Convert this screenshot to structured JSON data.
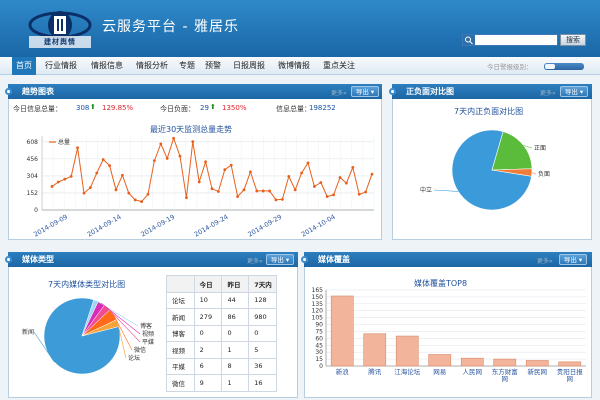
{
  "header": {
    "logo_text": "建材舆情",
    "title": "云服务平台 - 雅居乐",
    "search_button": "搜索"
  },
  "nav": {
    "items": [
      "首页",
      "行业情报",
      "情报信息",
      "情报分析",
      "专题",
      "预警",
      "日报周报",
      "微博情报",
      "重点关注"
    ],
    "alert_label": "今日警报级别："
  },
  "panels": {
    "trend": {
      "title": "趋势图表",
      "more": "更多»",
      "export": "导出",
      "stats": {
        "total_label": "今日信息总量：",
        "total_value": "308",
        "total_pct": "129.85%",
        "negative_label": "今日负面：",
        "negative_value": "29",
        "negative_pct": "1350%",
        "all_label": "信息总量：",
        "all_value": "198252"
      }
    },
    "sentiment": {
      "title": "正负面对比图",
      "more": "更多»",
      "export": "导出"
    },
    "media_type": {
      "title": "媒体类型",
      "more": "更多»",
      "export": "导出"
    },
    "media_cover": {
      "title": "媒体覆盖",
      "more": "更多»",
      "export": "导出"
    }
  },
  "colors": {
    "header": "#1f75b8",
    "line": "#e8601c",
    "pie_neutral": "#3b9ad9",
    "pie_positive": "#5bbb3a",
    "pie_negative": "#ef7d37",
    "bar": "#f2b49a"
  },
  "chart_data": [
    {
      "type": "line",
      "title": "最近30天监测总量走势",
      "legend": "总量",
      "x_ticks": [
        "2014-09-09",
        "2014-09-14",
        "2014-09-19",
        "2014-09-24",
        "2014-09-29",
        "2014-10-04"
      ],
      "y_ticks": [
        0,
        152,
        304,
        456,
        608
      ],
      "ylim": [
        0,
        660
      ],
      "values": [
        210,
        250,
        275,
        300,
        555,
        150,
        200,
        330,
        450,
        395,
        180,
        310,
        150,
        90,
        75,
        140,
        440,
        590,
        460,
        640,
        480,
        110,
        610,
        250,
        430,
        190,
        165,
        360,
        400,
        120,
        180,
        340,
        170,
        170,
        170,
        90,
        95,
        300,
        180,
        330,
        420,
        210,
        245,
        120,
        135,
        290,
        240,
        380,
        140,
        160,
        320
      ]
    },
    {
      "type": "pie",
      "title": "7天内正负面对比图",
      "labels": [
        "中立",
        "正面",
        "负面"
      ],
      "values": [
        77,
        20,
        3
      ]
    },
    {
      "type": "pie",
      "title": "7天内媒体类型对比图",
      "labels": [
        "新闻",
        "博客",
        "视频",
        "平媒",
        "微信",
        "论坛"
      ],
      "values": [
        84,
        2,
        3,
        3,
        5,
        3
      ]
    },
    {
      "type": "table",
      "columns": [
        "",
        "今日",
        "昨日",
        "7天内"
      ],
      "rows": [
        [
          "论坛",
          "10",
          "44",
          "128"
        ],
        [
          "新闻",
          "279",
          "86",
          "980"
        ],
        [
          "博客",
          "0",
          "0",
          "0"
        ],
        [
          "视频",
          "2",
          "1",
          "5"
        ],
        [
          "平媒",
          "6",
          "8",
          "36"
        ],
        [
          "微信",
          "9",
          "1",
          "16"
        ]
      ]
    },
    {
      "type": "bar",
      "title": "媒体覆盖TOP8",
      "categories": [
        "新浪",
        "腾讯",
        "江海论坛",
        "网易",
        "人民网",
        "东方财富网",
        "新民网",
        "贵阳日报网"
      ],
      "values": [
        152,
        70,
        65,
        25,
        17,
        15,
        12,
        9
      ],
      "y_ticks": [
        0,
        15,
        30,
        45,
        60,
        75,
        90,
        105,
        120,
        135,
        150,
        165
      ],
      "ylim": [
        0,
        165
      ]
    }
  ]
}
